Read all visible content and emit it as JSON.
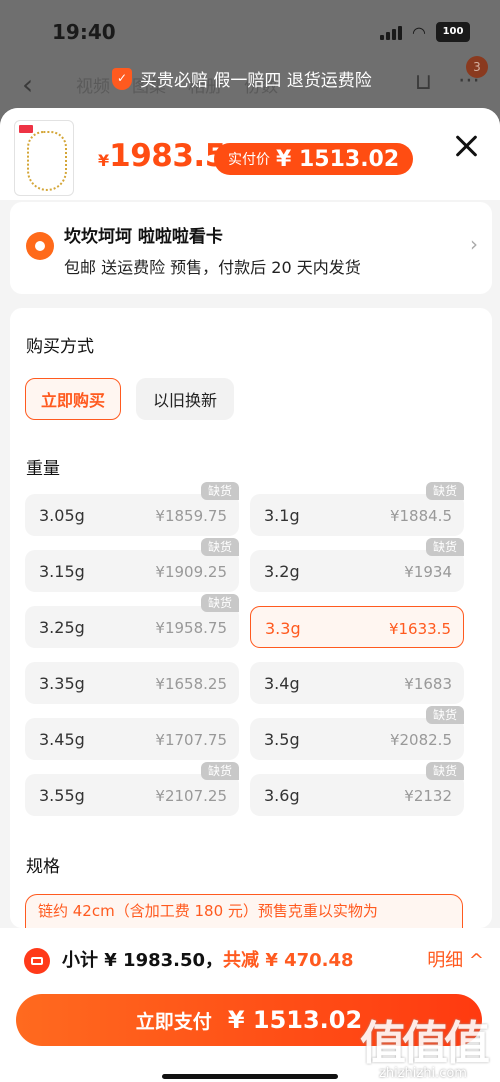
{
  "status": {
    "time": "19:40",
    "battery": "100"
  },
  "background": {
    "guarantee": "买贵必赔 假一赔四 退货运费险",
    "tabs": [
      "视频",
      "图集",
      "相册",
      "份数"
    ],
    "cart_badge": "3"
  },
  "header": {
    "currency": "¥",
    "price": "1983.5",
    "actual_label": "实付价",
    "actual_price": "¥ 1513.02"
  },
  "shop": {
    "name": "坎坎坷坷 啦啦啦看卡",
    "info": "包邮  送运费险  预售，付款后 20 天内发货"
  },
  "purchase": {
    "title": "购买方式",
    "options": [
      "立即购买",
      "以旧换新"
    ]
  },
  "weight": {
    "title": "重量",
    "soldout_label": "缺货",
    "items": [
      {
        "w": "3.05g",
        "p": "¥1859.75",
        "soldout": true
      },
      {
        "w": "3.1g",
        "p": "¥1884.5",
        "soldout": true
      },
      {
        "w": "3.15g",
        "p": "¥1909.25",
        "soldout": true
      },
      {
        "w": "3.2g",
        "p": "¥1934",
        "soldout": true
      },
      {
        "w": "3.25g",
        "p": "¥1958.75",
        "soldout": true
      },
      {
        "w": "3.3g",
        "p": "¥1633.5",
        "soldout": false,
        "selected": true
      },
      {
        "w": "3.35g",
        "p": "¥1658.25",
        "soldout": false
      },
      {
        "w": "3.4g",
        "p": "¥1683",
        "soldout": false
      },
      {
        "w": "3.45g",
        "p": "¥1707.75",
        "soldout": false
      },
      {
        "w": "3.5g",
        "p": "¥2082.5",
        "soldout": true
      },
      {
        "w": "3.55g",
        "p": "¥2107.25",
        "soldout": true
      },
      {
        "w": "3.6g",
        "p": "¥2132",
        "soldout": true
      }
    ]
  },
  "spec": {
    "title": "规格",
    "value": "链约 42cm（含加工费 180 元）预售克重以实物为"
  },
  "bottom": {
    "subtotal": "小计 ¥ 1983.50，",
    "discount": "共减 ¥ 470.48",
    "detail": "明细 ^",
    "pay_label": "立即支付",
    "pay_amount": "¥ 1513.02"
  },
  "watermark": {
    "big": "值值值",
    "small": "zhizhizhi.com"
  },
  "colors": {
    "accent": "#ff5a1f",
    "soldout": "#c8c8c8"
  }
}
